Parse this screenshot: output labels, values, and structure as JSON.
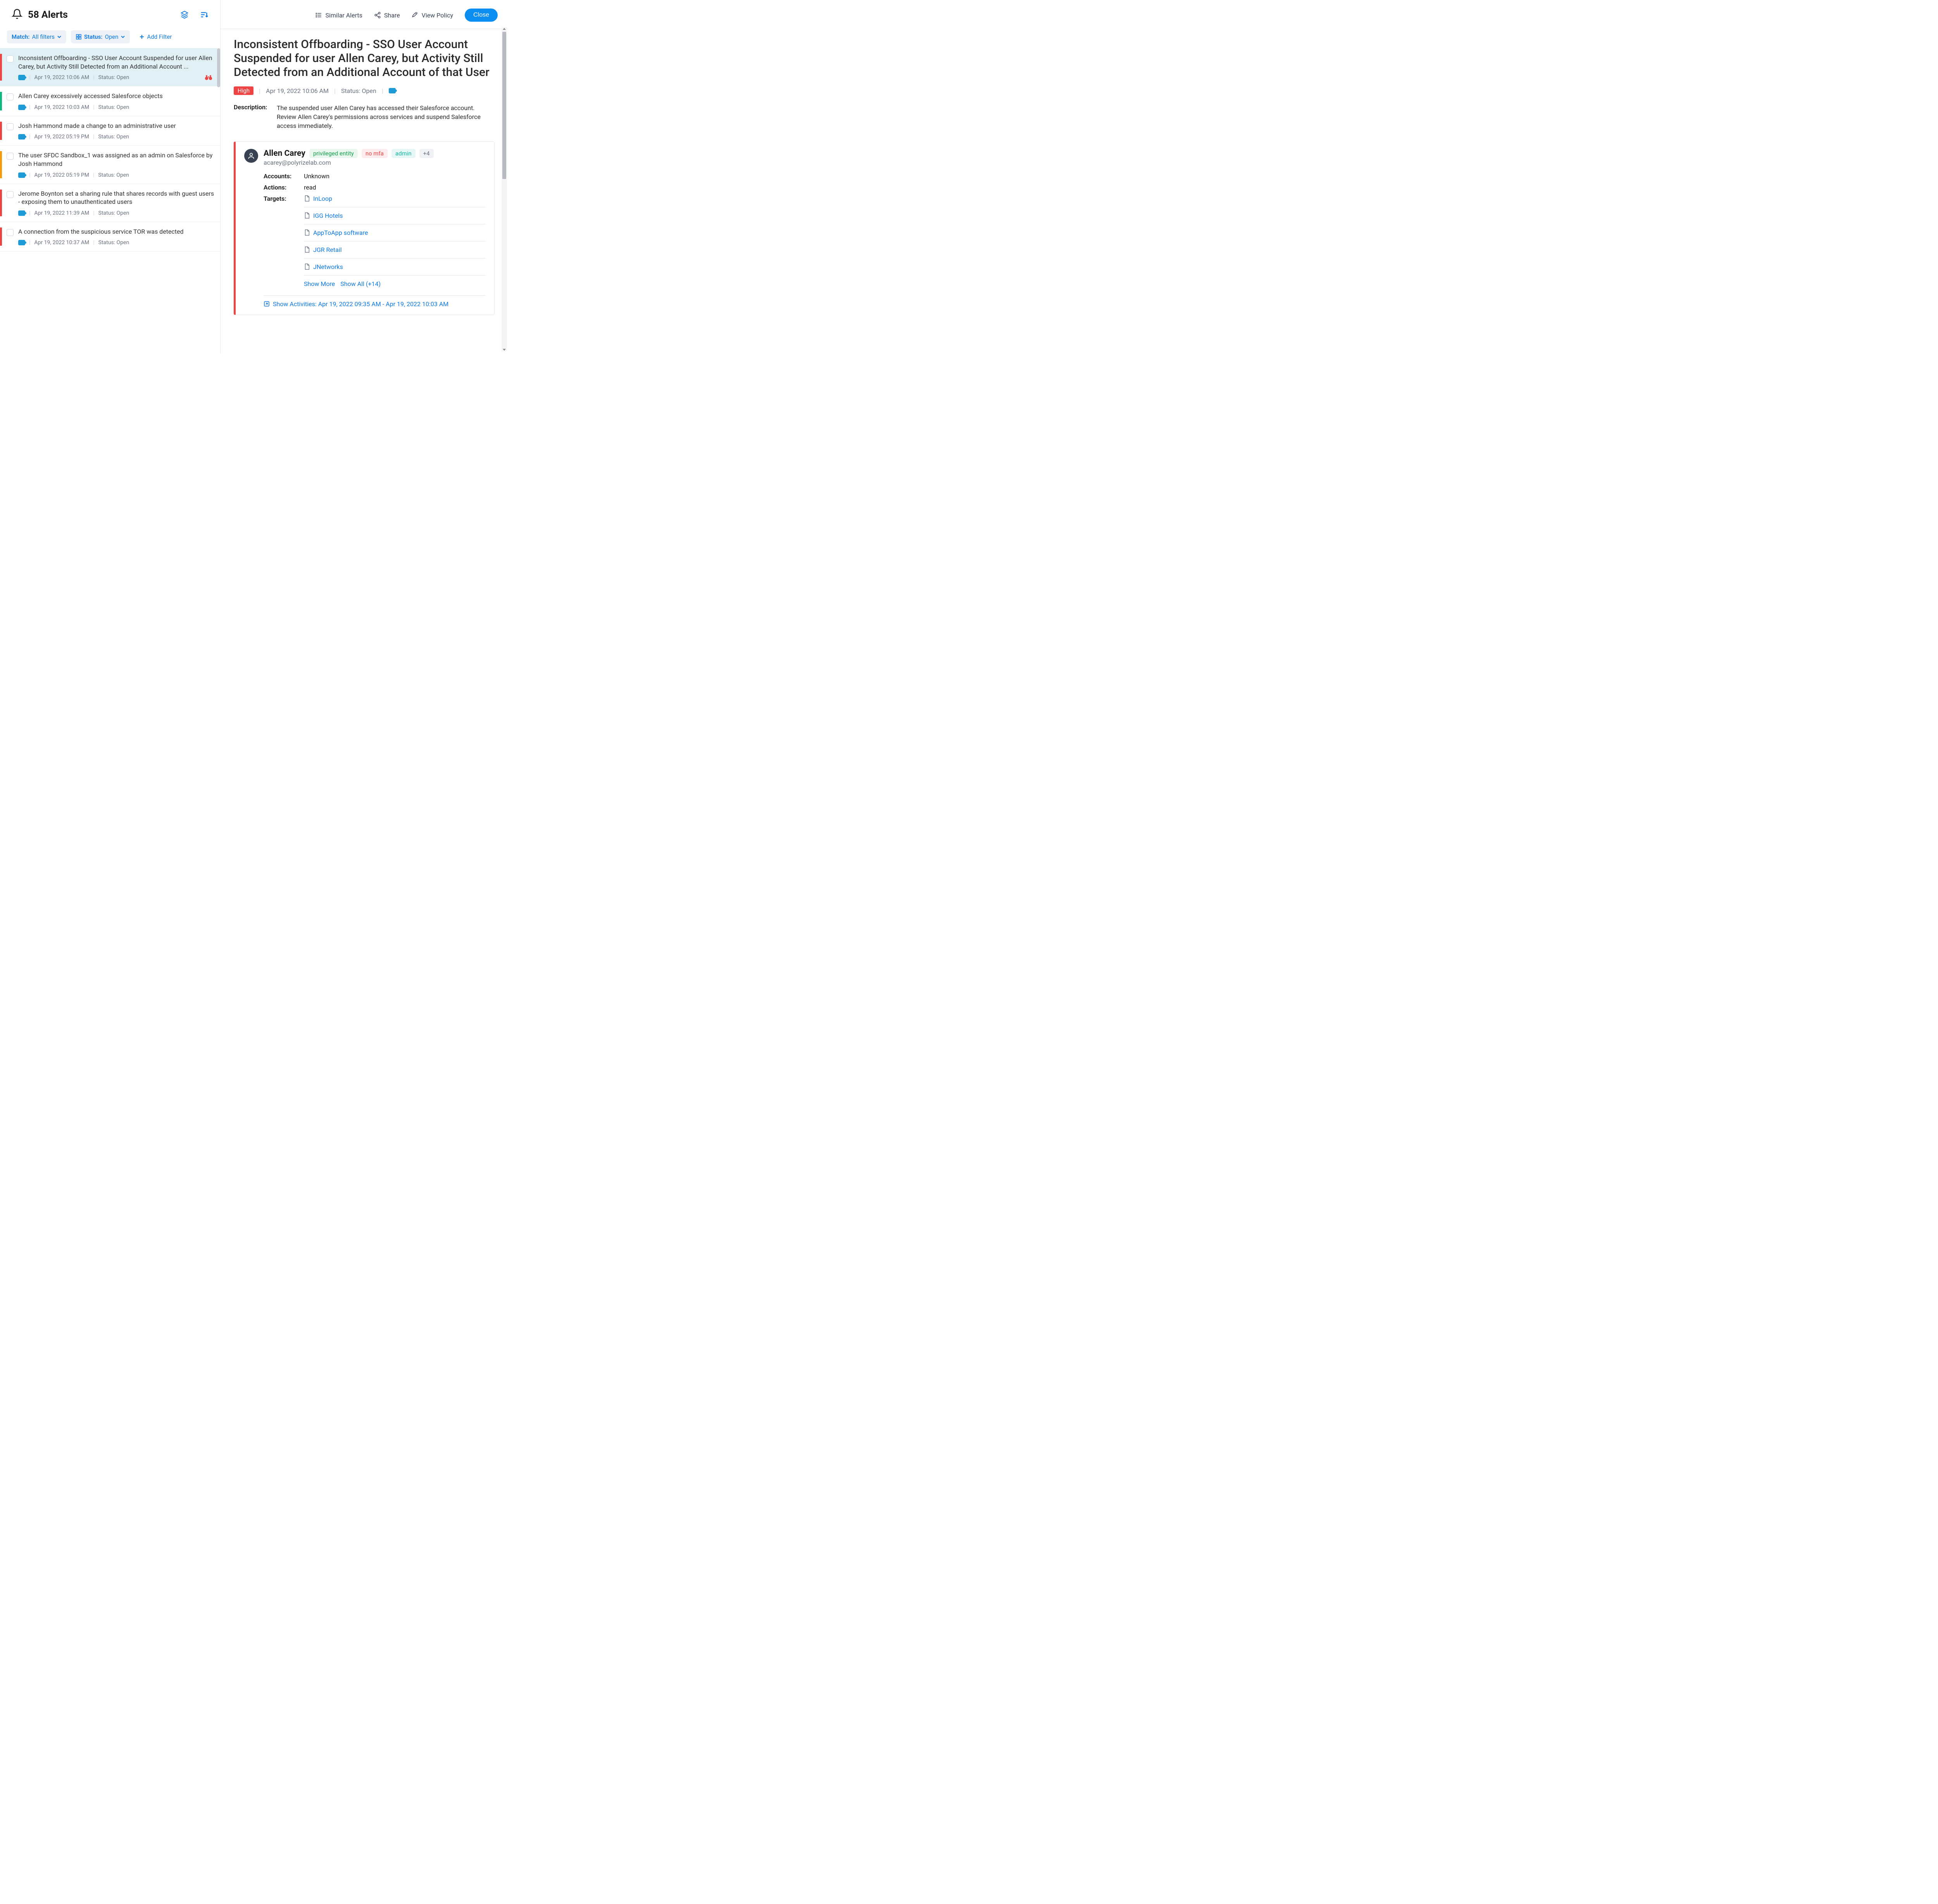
{
  "header": {
    "title": "58 Alerts"
  },
  "filters": {
    "match_label": "Match:",
    "match_value": "All filters",
    "status_label": "Status:",
    "status_value": "Open",
    "add_filter": "Add Filter"
  },
  "alerts": [
    {
      "severity": "red",
      "title": "Inconsistent Offboarding - SSO User Account Suspended for user Allen Carey, but Activity Still Detected from an Additional Account ...",
      "date": "Apr 19, 2022 10:06 AM",
      "status": "Status: Open",
      "active": true,
      "binoc": true
    },
    {
      "severity": "green",
      "title": "Allen Carey excessively accessed Salesforce objects",
      "date": "Apr 19, 2022 10:03 AM",
      "status": "Status: Open"
    },
    {
      "severity": "red",
      "title": "Josh Hammond made a change to an administrative user",
      "date": "Apr 19, 2022 05:19 PM",
      "status": "Status: Open"
    },
    {
      "severity": "yellow",
      "title": "The user SFDC Sandbox_1 was assigned as an admin on Salesforce by Josh Hammond",
      "date": "Apr 19, 2022 05:19 PM",
      "status": "Status: Open"
    },
    {
      "severity": "red",
      "title": "Jerome Boynton set a sharing rule that shares records with guest users - exposing them to unauthenticated users",
      "date": "Apr 19, 2022 11:39 AM",
      "status": "Status: Open"
    },
    {
      "severity": "red",
      "title": "A connection from the suspicious service TOR was detected",
      "date": "Apr 19, 2022 10:37 AM",
      "status": "Status: Open"
    }
  ],
  "right_header": {
    "similar": "Similar Alerts",
    "share": "Share",
    "view_policy": "View Policy",
    "close": "Close"
  },
  "detail": {
    "title": "Inconsistent Offboarding - SSO User Account Suspended for user Allen Carey, but Activity Still Detected from an Additional Account of that User",
    "severity": "High",
    "date": "Apr 19, 2022 10:06 AM",
    "status": "Status: Open",
    "desc_label": "Description:",
    "desc_text": "The suspended user Allen Carey has accessed their Salesforce account. Review Allen Carey's permissions across services and suspend Salesforce access immediately."
  },
  "identity": {
    "name": "Allen Carey",
    "email": "acarey@polyrizelab.com",
    "tags": {
      "privileged": "privileged entity",
      "nomfa": "no mfa",
      "admin": "admin",
      "more": "+4"
    },
    "accounts_label": "Accounts:",
    "accounts_value": "Unknown",
    "actions_label": "Actions:",
    "actions_value": "read",
    "targets_label": "Targets:",
    "targets": [
      "InLoop",
      "IGG Hotels",
      "AppToApp software",
      "JGR Retail",
      "JNetworks"
    ],
    "show_more": "Show More",
    "show_all": "Show All (+14)",
    "activities": "Show Activities: Apr 19, 2022 09:35 AM - Apr 19, 2022 10:03 AM"
  }
}
